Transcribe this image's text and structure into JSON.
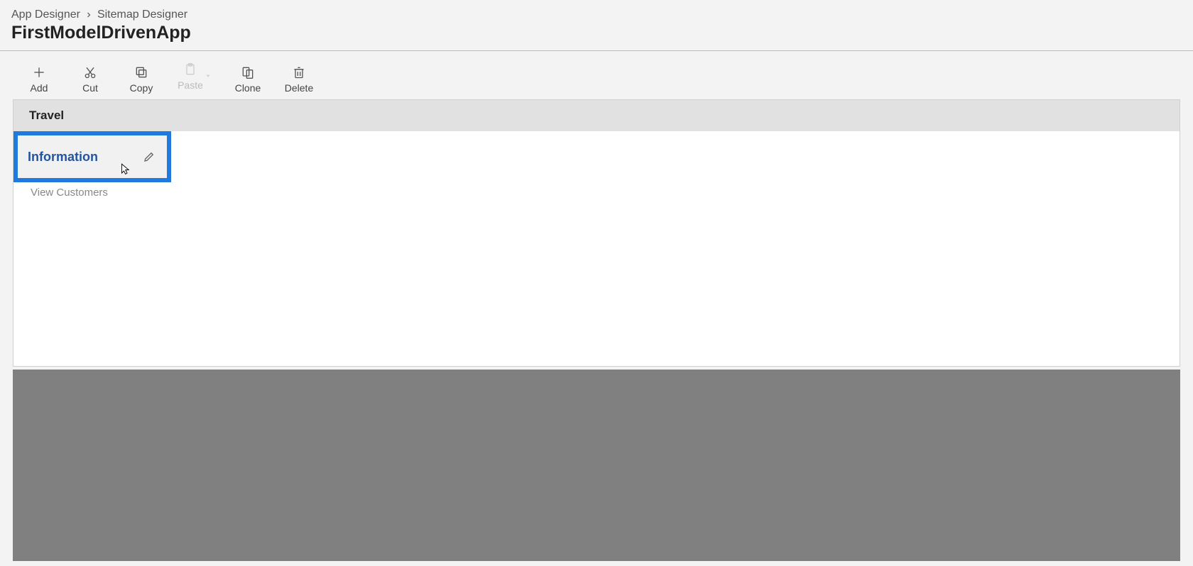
{
  "breadcrumb": {
    "root": "App Designer",
    "page": "Sitemap Designer"
  },
  "app_title": "FirstModelDrivenApp",
  "toolbar": {
    "add": {
      "label": "Add"
    },
    "cut": {
      "label": "Cut"
    },
    "copy": {
      "label": "Copy"
    },
    "paste": {
      "label": "Paste"
    },
    "clone": {
      "label": "Clone"
    },
    "delete": {
      "label": "Delete"
    }
  },
  "sitemap": {
    "area_label": "Travel",
    "group_label": "Information",
    "subarea_label": "View Customers"
  }
}
